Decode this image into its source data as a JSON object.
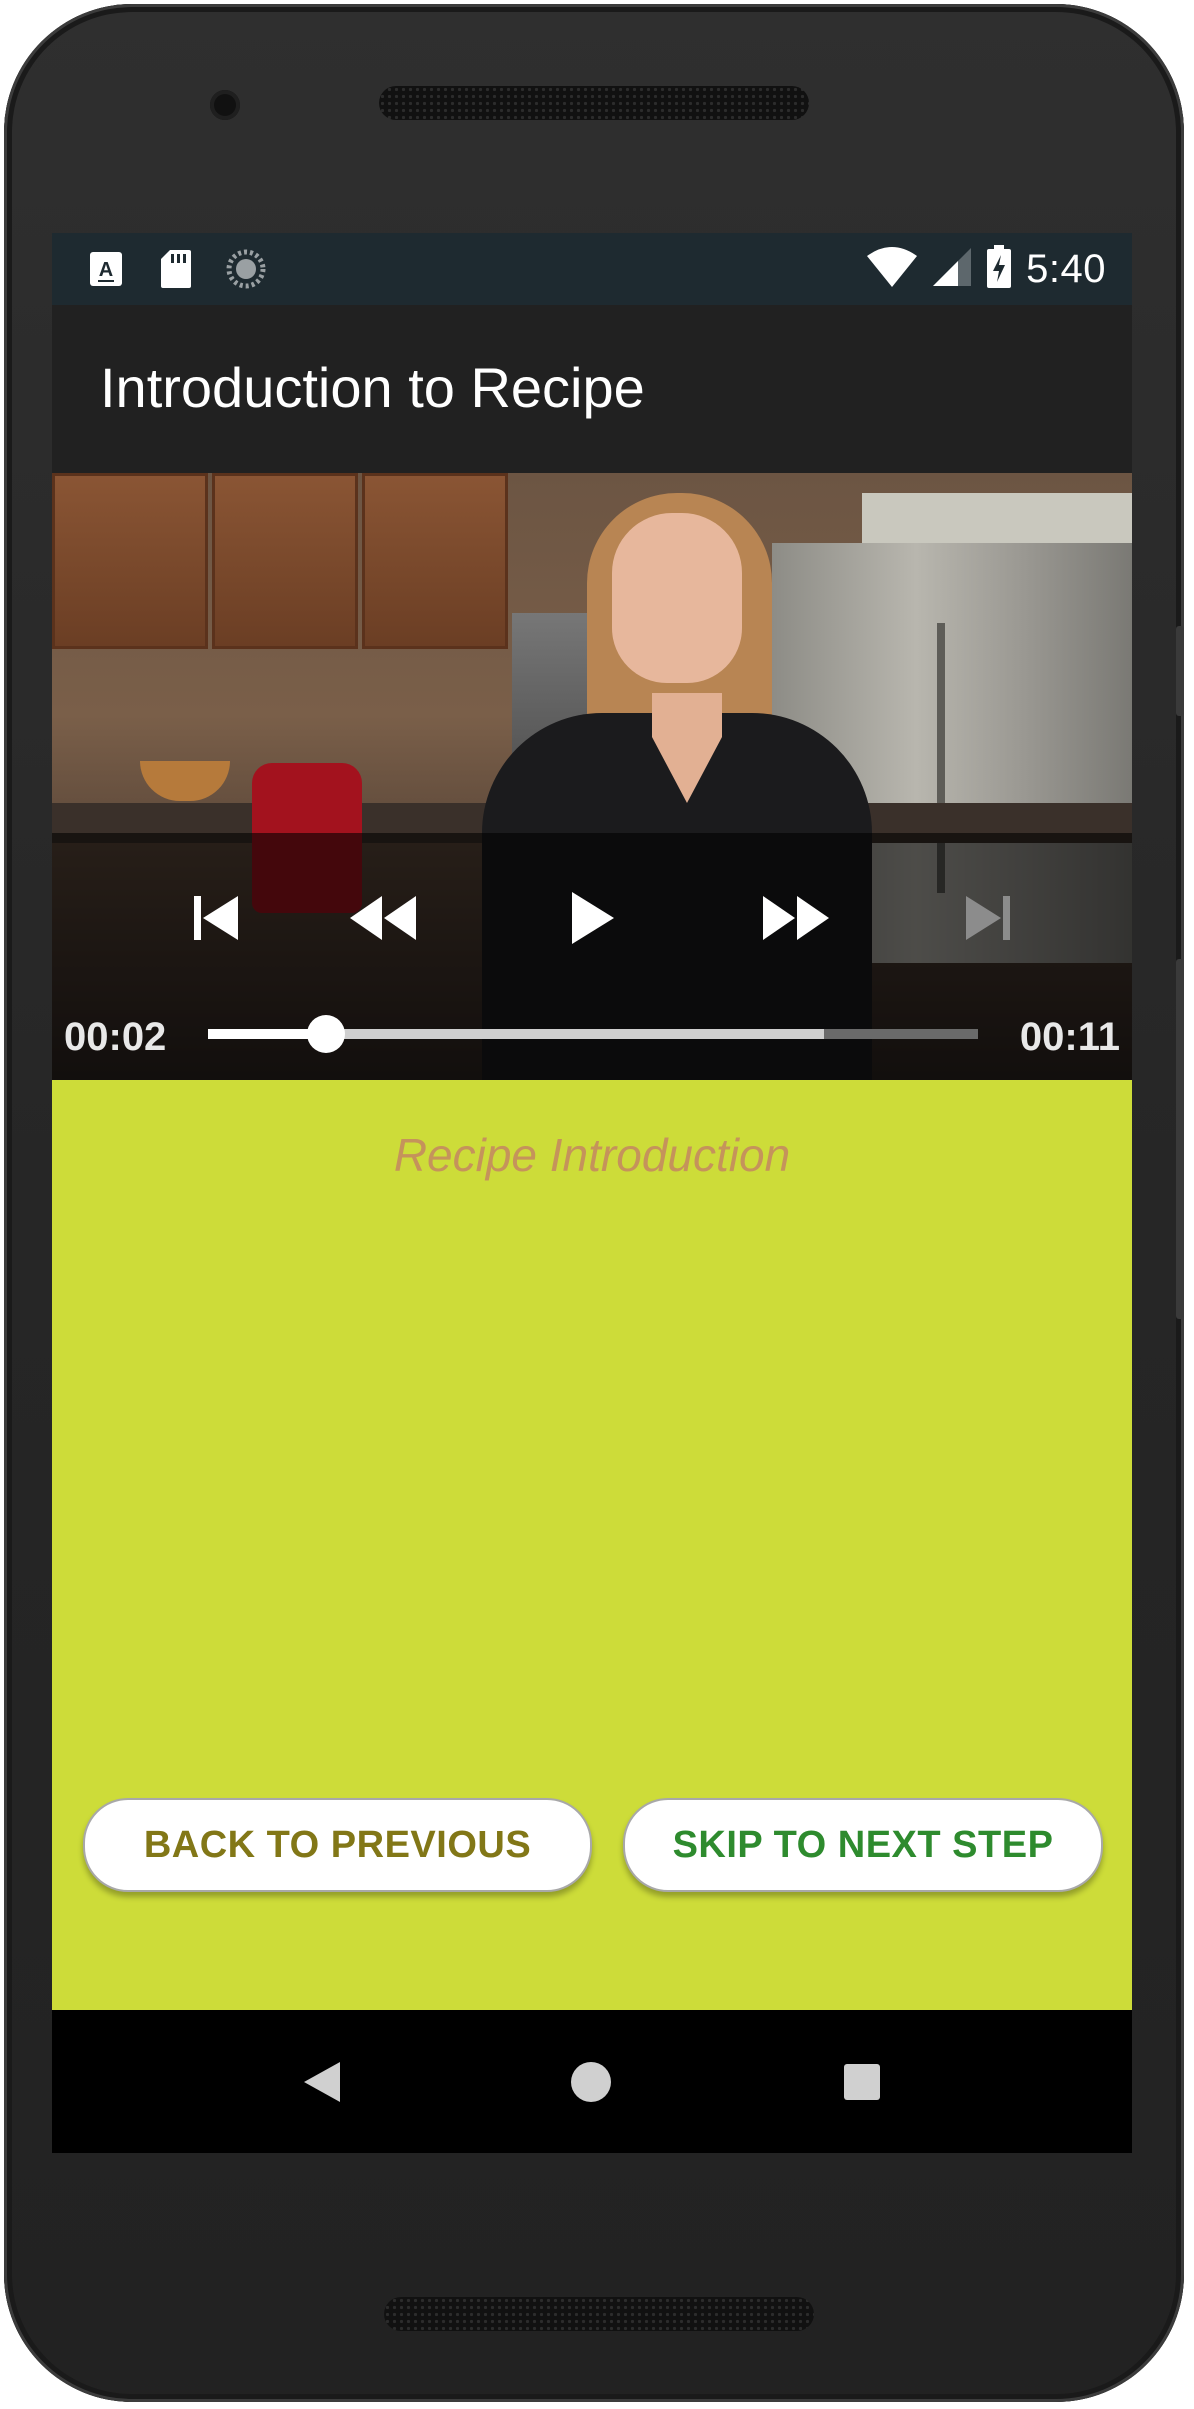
{
  "status_bar": {
    "time": "5:40",
    "left_icons": [
      "a-notification-icon",
      "sd-card-icon",
      "sync-icon"
    ],
    "right_icons": [
      "wifi-icon",
      "signal-icon",
      "battery-charging-icon"
    ]
  },
  "app_bar": {
    "title": "Introduction to Recipe"
  },
  "player": {
    "position": "00:02",
    "duration": "00:11",
    "played_fraction": 0.153,
    "buffered_fraction": 0.8,
    "controls": [
      "previous-icon",
      "rewind-icon",
      "play-icon",
      "fast-forward-icon",
      "next-icon"
    ]
  },
  "step": {
    "description": "Recipe Introduction"
  },
  "buttons": {
    "previous": "BACK TO PREVIOUS",
    "next": "SKIP TO NEXT STEP"
  },
  "colors": {
    "content_bg": "#cddc39",
    "description": "#c5935b",
    "previous_text": "#827717",
    "next_text": "#2e8b2e",
    "status_bar": "#1e2a30",
    "app_bar": "#212121"
  },
  "nav_bar": [
    "back-icon",
    "home-icon",
    "recents-icon"
  ]
}
